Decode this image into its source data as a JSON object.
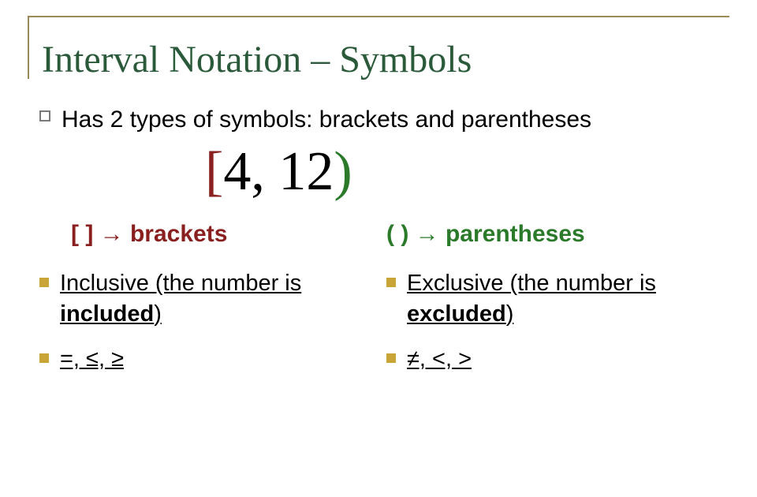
{
  "title": "Interval Notation – Symbols",
  "main_bullet": "Has 2 types of symbols: brackets and parentheses",
  "example": {
    "open": "[",
    "mid": "4, 12",
    "close": ")"
  },
  "labels": {
    "brackets": "[   ] → brackets",
    "parentheses": "(   ) → parentheses"
  },
  "left_col": {
    "item1_prefix": "Inclusive (the number is ",
    "item1_bold": "included",
    "item1_suffix": ")",
    "item2": "=, ≤, ≥"
  },
  "right_col": {
    "item1_prefix": "Exclusive (the number is ",
    "item1_bold": "excluded",
    "item1_suffix": ")",
    "item2": "≠, <, >"
  }
}
